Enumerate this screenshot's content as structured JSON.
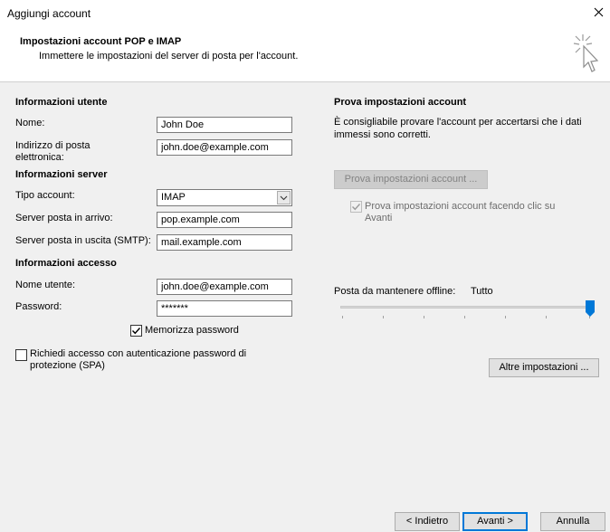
{
  "window": {
    "title": "Aggiungi account"
  },
  "header": {
    "title": "Impostazioni account POP e IMAP",
    "subtitle": "Immettere le impostazioni del server di posta per l'account."
  },
  "user_info": {
    "heading": "Informazioni utente",
    "name_label": "Nome:",
    "name_value": "John Doe",
    "email_label_line1": "Indirizzo di posta",
    "email_label_line2": "elettronica:",
    "email_value": "john.doe@example.com"
  },
  "server_info": {
    "heading": "Informazioni server",
    "account_type_label": "Tipo account:",
    "account_type_value": "IMAP",
    "incoming_label": "Server posta in arrivo:",
    "incoming_value": "pop.example.com",
    "outgoing_label": "Server posta in uscita (SMTP):",
    "outgoing_value": "mail.example.com"
  },
  "login_info": {
    "heading": "Informazioni accesso",
    "username_label": "Nome utente:",
    "username_value": "john.doe@example.com",
    "password_label": "Password:",
    "password_value": "*******",
    "remember_label": "Memorizza password",
    "remember_checked": true,
    "spa_label_line1": "Richiedi accesso con autenticazione password di",
    "spa_label_line2": "protezione (SPA)",
    "spa_checked": false
  },
  "test_settings": {
    "heading": "Prova impostazioni account",
    "description_line1": "È consigliabile provare l'account per accertarsi che i dati",
    "description_line2": "immessi sono corretti.",
    "test_button": "Prova impostazioni account ...",
    "auto_test_line1": "Prova impostazioni account facendo clic su",
    "auto_test_line2": "Avanti",
    "auto_test_checked": true
  },
  "offline": {
    "label": "Posta da mantenere offline:",
    "value": "Tutto",
    "slider_level": 1.0
  },
  "buttons": {
    "more_settings": "Altre impostazioni ...",
    "back": "< Indietro",
    "next": "Avanti >",
    "cancel": "Annulla"
  },
  "colors": {
    "accent": "#0078d7",
    "dialog_bg": "#f0f0f0"
  }
}
